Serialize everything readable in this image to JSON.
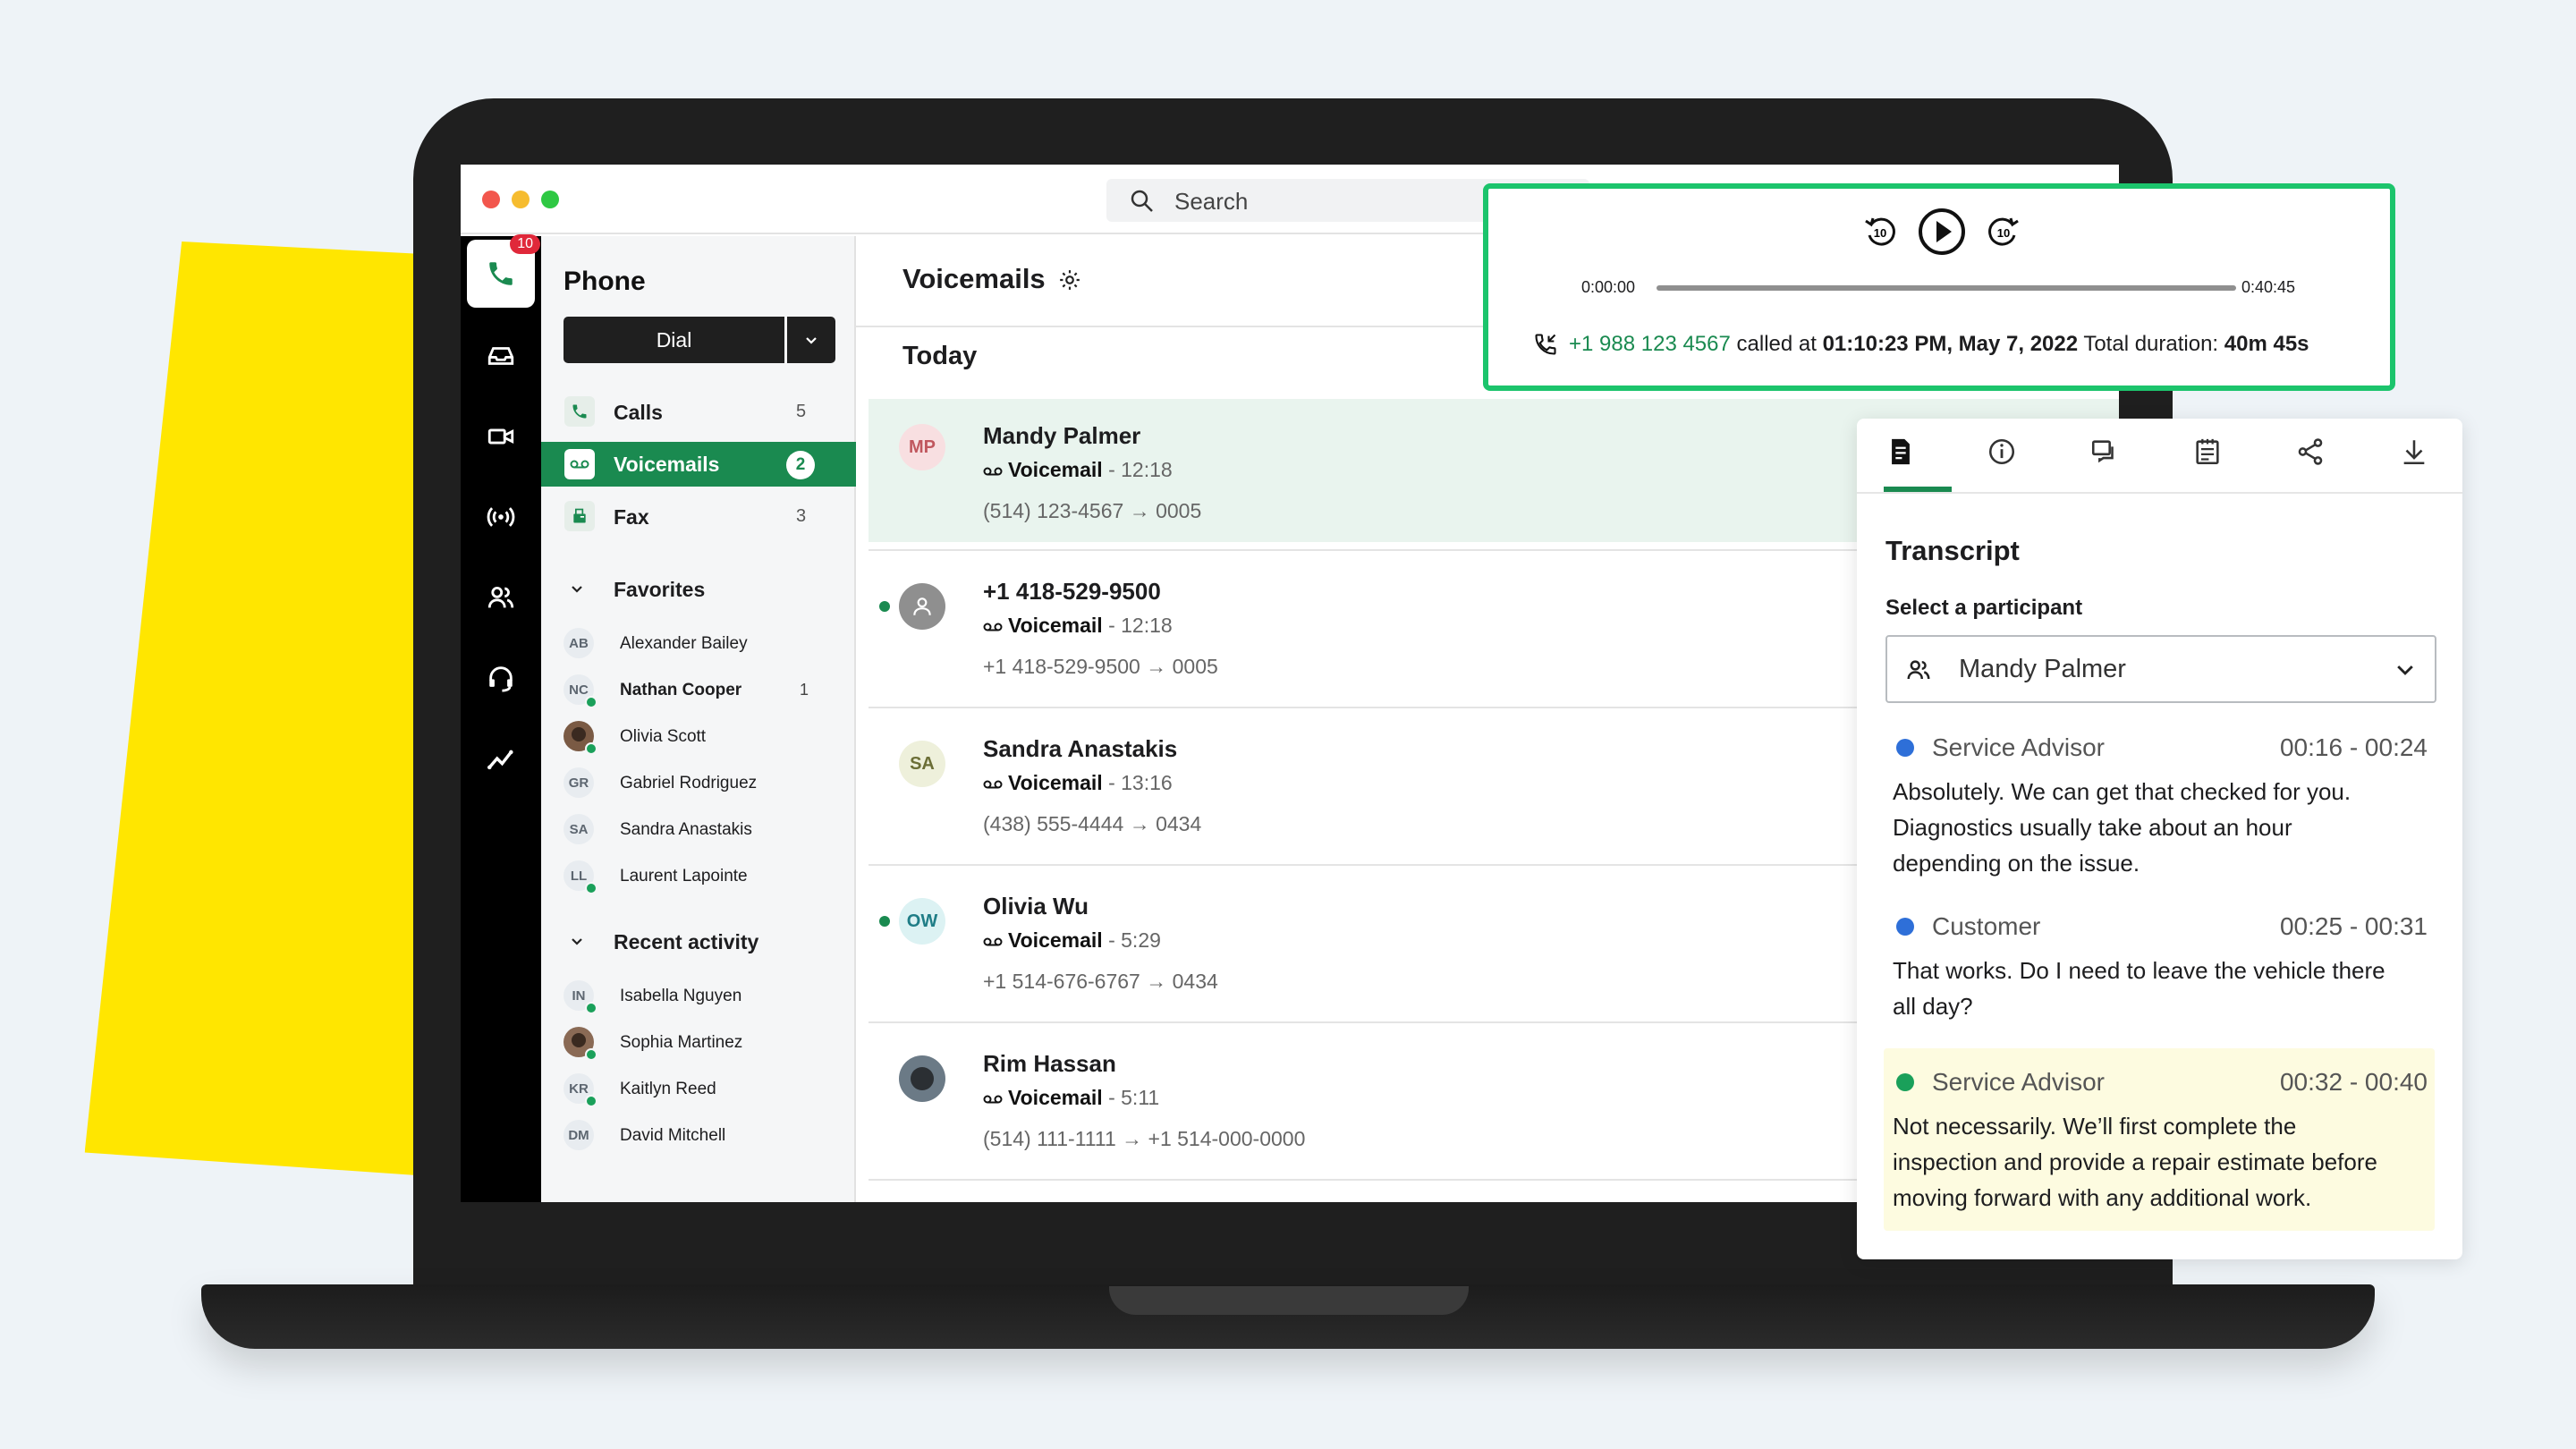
{
  "search": {
    "placeholder": "Search"
  },
  "rail": {
    "badge": "10"
  },
  "phone": {
    "title": "Phone",
    "dial_label": "Dial",
    "nav": [
      {
        "label": "Calls",
        "count": "5"
      },
      {
        "label": "Voicemails",
        "count": "2"
      },
      {
        "label": "Fax",
        "count": "3"
      }
    ],
    "favorites": {
      "title": "Favorites",
      "items": [
        {
          "initials": "AB",
          "name": "Alexander Bailey",
          "count": ""
        },
        {
          "initials": "NC",
          "name": "Nathan Cooper",
          "count": "1"
        },
        {
          "initials": "",
          "name": "Olivia Scott",
          "count": ""
        },
        {
          "initials": "GR",
          "name": "Gabriel Rodriguez",
          "count": ""
        },
        {
          "initials": "SA",
          "name": "Sandra Anastakis",
          "count": ""
        },
        {
          "initials": "LL",
          "name": "Laurent Lapointe",
          "count": ""
        }
      ]
    },
    "recent": {
      "title": "Recent activity",
      "items": [
        {
          "initials": "IN",
          "name": "Isabella Nguyen"
        },
        {
          "initials": "",
          "name": "Sophia Martinez"
        },
        {
          "initials": "KR",
          "name": "Kaitlyn Reed"
        },
        {
          "initials": "DM",
          "name": "David Mitchell"
        }
      ]
    }
  },
  "voicemails": {
    "title": "Voicemails",
    "section": "Today",
    "items": [
      {
        "initials": "MP",
        "name": "Mandy Palmer",
        "type": "Voicemail",
        "time": "12:18",
        "from": "(514) 123-4567",
        "to": "0005"
      },
      {
        "initials": "",
        "name": "+1 418-529-9500",
        "type": "Voicemail",
        "time": "12:18",
        "from": "+1 418-529-9500",
        "to": "0005"
      },
      {
        "initials": "SA",
        "name": "Sandra Anastakis",
        "type": "Voicemail",
        "time": "13:16",
        "from": "(438) 555-4444",
        "to": "0434"
      },
      {
        "initials": "OW",
        "name": "Olivia Wu",
        "type": "Voicemail",
        "time": "5:29",
        "from": "+1 514-676-6767",
        "to": "0434"
      },
      {
        "initials": "",
        "name": "Rim Hassan",
        "type": "Voicemail",
        "time": "5:11",
        "from": "(514) 111-1111",
        "to": "+1 514-000-0000"
      }
    ]
  },
  "player": {
    "start": "0:00:00",
    "end": "0:40:45",
    "progress": 0,
    "caller": "+1 988 123 4567",
    "called_at_label": "called at",
    "called_time": "01:10:23 PM,",
    "called_date": "May 7, 2022",
    "total_label": "Total duration:",
    "total_value": "40m 45s"
  },
  "transcript": {
    "title": "Transcript",
    "select_label": "Select a participant",
    "participant": "Mandy Palmer",
    "segments": [
      {
        "speaker": "Service Advisor",
        "range": "00:16 - 00:24",
        "lines": [
          "Absolutely. We can get that checked for you.",
          "Diagnostics usually take about an hour",
          "depending on the issue."
        ]
      },
      {
        "speaker": "Customer",
        "range": "00:25 - 00:31",
        "lines": [
          "That works. Do I need to leave the vehicle there",
          "all day?"
        ]
      },
      {
        "speaker": "Service Advisor",
        "range": "00:32 - 00:40",
        "lines": [
          "Not necessarily. We’ll first complete the",
          "inspection and provide a repair estimate before",
          "moving forward with any additional work."
        ]
      }
    ]
  },
  "colors": {
    "accent": "#1a8a50",
    "highlight": "#fdfbe0",
    "player_border": "#1cc46c",
    "speaker_blue": "#2e6fd8"
  }
}
